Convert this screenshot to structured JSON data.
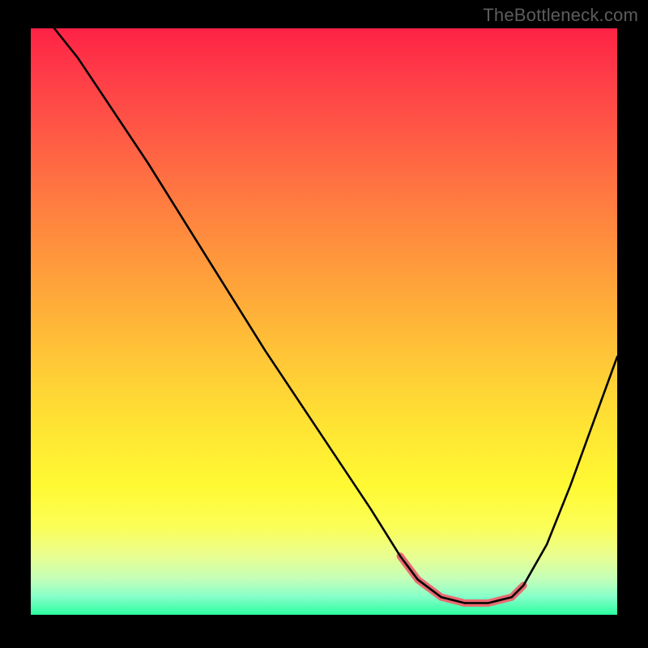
{
  "watermark": "TheBottleneck.com",
  "chart_data": {
    "type": "line",
    "title": "",
    "xlabel": "",
    "ylabel": "",
    "xlim": [
      0,
      100
    ],
    "ylim": [
      0,
      100
    ],
    "series": [
      {
        "name": "curve",
        "x": [
          4,
          8,
          12,
          20,
          30,
          40,
          50,
          58,
          63,
          66,
          70,
          74,
          78,
          82,
          84,
          88,
          92,
          96,
          100
        ],
        "values": [
          100,
          95,
          89,
          77,
          61,
          45,
          30,
          18,
          10,
          6,
          3,
          2,
          2,
          3,
          5,
          12,
          22,
          33,
          44
        ]
      }
    ],
    "highlight_band": {
      "x_start": 63,
      "x_end": 84,
      "color": "#ea6a71"
    },
    "gradient_stops": [
      {
        "pos": 0,
        "color": "#fe2245"
      },
      {
        "pos": 8,
        "color": "#fe3c48"
      },
      {
        "pos": 20,
        "color": "#ff5f44"
      },
      {
        "pos": 32,
        "color": "#ff833f"
      },
      {
        "pos": 44,
        "color": "#ffa43a"
      },
      {
        "pos": 56,
        "color": "#ffc637"
      },
      {
        "pos": 68,
        "color": "#ffe433"
      },
      {
        "pos": 78,
        "color": "#fff933"
      },
      {
        "pos": 85,
        "color": "#fbfe57"
      },
      {
        "pos": 90,
        "color": "#e9fe91"
      },
      {
        "pos": 94,
        "color": "#c2ffba"
      },
      {
        "pos": 97,
        "color": "#84ffc9"
      },
      {
        "pos": 100,
        "color": "#2bfd9f"
      }
    ]
  }
}
